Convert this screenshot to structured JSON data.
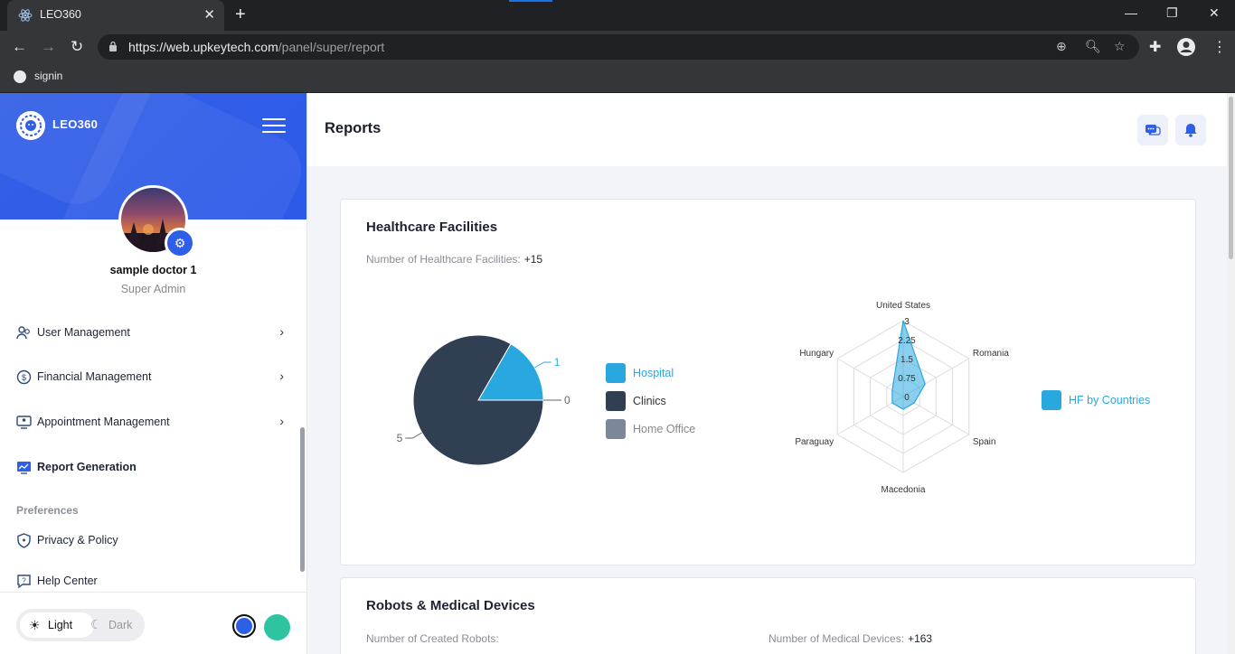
{
  "browser": {
    "tab_title": "LEO360",
    "tab_close": "✕",
    "new_tab": "+",
    "url_host": "https://web.upkeytech.com",
    "url_path": "/panel/super/report",
    "bookmark_label": "signin"
  },
  "sidebar": {
    "logo_text": "LEO360",
    "user_name": "sample doctor 1",
    "user_role": "Super Admin",
    "menu": [
      {
        "label": "User Management",
        "has_chevron": true
      },
      {
        "label": "Financial Management",
        "has_chevron": true
      },
      {
        "label": "Appointment Management",
        "has_chevron": true
      },
      {
        "label": "Report Generation",
        "has_chevron": false,
        "active": true
      }
    ],
    "section_preferences": "Preferences",
    "pref_items": [
      {
        "label": "Privacy & Policy"
      },
      {
        "label": "Help Center"
      }
    ],
    "theme": {
      "light_label": "Light",
      "dark_label": "Dark"
    },
    "colors": {
      "blue": "#2d5ee6",
      "green": "#2ec4a0"
    }
  },
  "header": {
    "title": "Reports"
  },
  "cards": {
    "healthcare": {
      "title": "Healthcare Facilities",
      "count_label": "Number of Healthcare Facilities:",
      "count_value": "+15"
    },
    "robots": {
      "title": "Robots & Medical Devices",
      "robots_label": "Number of Created Robots:",
      "devices_label": "Number of Medical Devices:",
      "devices_value": "+163"
    }
  },
  "chart_data": [
    {
      "type": "pie",
      "categories": [
        "Hospital",
        "Clinics",
        "Home Office"
      ],
      "values": [
        1,
        5,
        0
      ],
      "colors": [
        "#29a8e0",
        "#313f52",
        "#7c8899"
      ],
      "data_labels": [
        "1",
        "5",
        "0"
      ]
    },
    {
      "type": "radar",
      "categories": [
        "United States",
        "Romania",
        "Spain",
        "Macedonia",
        "Paraguay",
        "Hungary"
      ],
      "series": [
        {
          "name": "HF by Countries",
          "values": [
            3,
            1,
            0.5,
            0.5,
            0.5,
            0.5
          ]
        }
      ],
      "tick_labels": [
        "0",
        "0.75",
        "1.5",
        "2.25",
        "3"
      ],
      "range": [
        0,
        3
      ],
      "color": "#29a8e0"
    }
  ]
}
